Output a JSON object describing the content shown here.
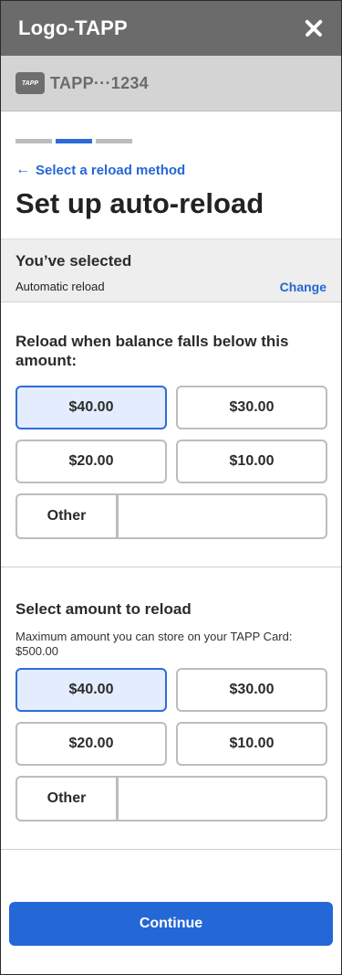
{
  "header": {
    "brand": "Logo-TAPP",
    "close_label": "✕"
  },
  "card": {
    "chip": "TAPP",
    "number": "TAPP···1234"
  },
  "progress": {
    "steps": 3,
    "current": 2
  },
  "nav": {
    "back_label": "Select a reload method",
    "back_icon": "←"
  },
  "title": "Set up auto-reload",
  "selection": {
    "heading": "You’ve selected",
    "value": "Automatic reload",
    "change_label": "Change"
  },
  "threshold": {
    "heading": "Reload when balance falls below this amount:",
    "options": [
      "$40.00",
      "$30.00",
      "$20.00",
      "$10.00"
    ],
    "selected": "$40.00",
    "other_label": "Other",
    "other_value": ""
  },
  "reload_amount": {
    "heading": "Select amount to reload",
    "note": "Maximum amount you can store on your TAPP Card: $500.00",
    "options": [
      "$40.00",
      "$30.00",
      "$20.00",
      "$10.00"
    ],
    "selected": "$40.00",
    "other_label": "Other",
    "other_value": ""
  },
  "footer": {
    "continue_label": "Continue"
  },
  "colors": {
    "accent": "#2467d6",
    "selected_bg": "#e3edfd",
    "topbar": "#6b6b6b"
  }
}
